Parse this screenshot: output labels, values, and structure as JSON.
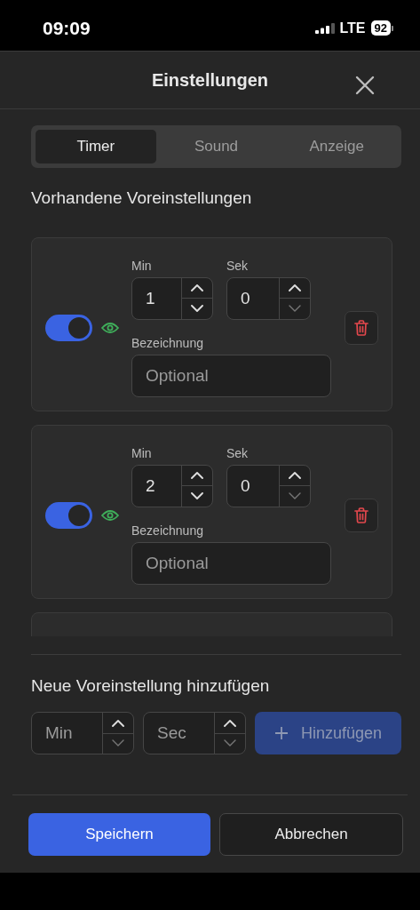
{
  "status_bar": {
    "time": "09:09",
    "network": "LTE",
    "battery": "92"
  },
  "dialog": {
    "title": "Einstellungen"
  },
  "tabs": [
    {
      "label": "Timer",
      "selected": true
    },
    {
      "label": "Sound",
      "selected": false
    },
    {
      "label": "Anzeige",
      "selected": false
    }
  ],
  "presets_heading": "Vorhandene Voreinstellungen",
  "presets": [
    {
      "enabled": true,
      "visible": true,
      "min_label": "Min",
      "min": {
        "value": "1",
        "down_disabled": false
      },
      "sec_label": "Sek",
      "sec": {
        "value": "0",
        "down_disabled": true
      },
      "name_label": "Bezeichnung",
      "name_placeholder": "Optional"
    },
    {
      "enabled": true,
      "visible": true,
      "min_label": "Min",
      "min": {
        "value": "2",
        "down_disabled": false
      },
      "sec_label": "Sek",
      "sec": {
        "value": "0",
        "down_disabled": true
      },
      "name_label": "Bezeichnung",
      "name_placeholder": "Optional"
    }
  ],
  "new_preset": {
    "heading": "Neue Voreinstellung hinzufügen",
    "min": {
      "placeholder": "Min",
      "down_disabled": true
    },
    "sec": {
      "placeholder": "Sec",
      "down_disabled": true
    },
    "add_button": {
      "label": "Hinzufügen",
      "disabled": true
    }
  },
  "buttons": [
    {
      "label": "Speichern",
      "kind": "primary"
    },
    {
      "label": "Abbrechen",
      "kind": "secondary"
    }
  ]
}
